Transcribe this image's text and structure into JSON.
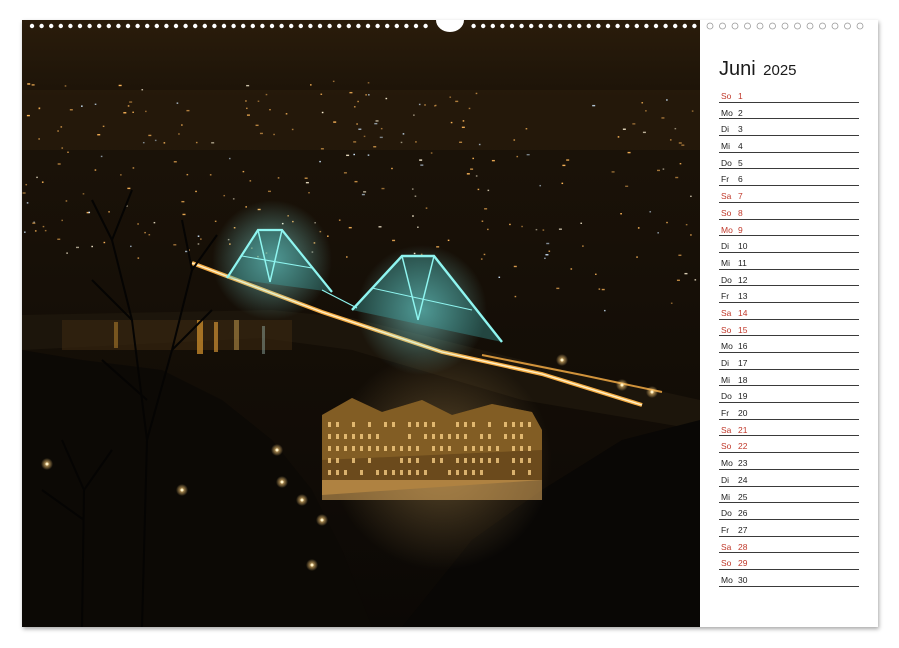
{
  "calendar": {
    "month": "Juni",
    "year": "2025",
    "weekend_color": "#c0392b",
    "days": [
      {
        "name": "So",
        "num": "1",
        "weekend": true
      },
      {
        "name": "Mo",
        "num": "2",
        "weekend": false
      },
      {
        "name": "Di",
        "num": "3",
        "weekend": false
      },
      {
        "name": "Mi",
        "num": "4",
        "weekend": false
      },
      {
        "name": "Do",
        "num": "5",
        "weekend": false
      },
      {
        "name": "Fr",
        "num": "6",
        "weekend": false
      },
      {
        "name": "Sa",
        "num": "7",
        "weekend": true
      },
      {
        "name": "So",
        "num": "8",
        "weekend": true
      },
      {
        "name": "Mo",
        "num": "9",
        "weekend": true
      },
      {
        "name": "Di",
        "num": "10",
        "weekend": false
      },
      {
        "name": "Mi",
        "num": "11",
        "weekend": false
      },
      {
        "name": "Do",
        "num": "12",
        "weekend": false
      },
      {
        "name": "Fr",
        "num": "13",
        "weekend": false
      },
      {
        "name": "Sa",
        "num": "14",
        "weekend": true
      },
      {
        "name": "So",
        "num": "15",
        "weekend": true
      },
      {
        "name": "Mo",
        "num": "16",
        "weekend": false
      },
      {
        "name": "Di",
        "num": "17",
        "weekend": false
      },
      {
        "name": "Mi",
        "num": "18",
        "weekend": false
      },
      {
        "name": "Do",
        "num": "19",
        "weekend": false
      },
      {
        "name": "Fr",
        "num": "20",
        "weekend": false
      },
      {
        "name": "Sa",
        "num": "21",
        "weekend": true
      },
      {
        "name": "So",
        "num": "22",
        "weekend": true
      },
      {
        "name": "Mo",
        "num": "23",
        "weekend": false
      },
      {
        "name": "Di",
        "num": "24",
        "weekend": false
      },
      {
        "name": "Mi",
        "num": "25",
        "weekend": false
      },
      {
        "name": "Do",
        "num": "26",
        "weekend": false
      },
      {
        "name": "Fr",
        "num": "27",
        "weekend": false
      },
      {
        "name": "Sa",
        "num": "28",
        "weekend": true
      },
      {
        "name": "So",
        "num": "29",
        "weekend": true
      },
      {
        "name": "Mo",
        "num": "30",
        "weekend": false
      }
    ]
  },
  "photo": {
    "subject": "night-city-bridge-photo",
    "bridge_color": "#7fe3e0",
    "light_color": "#ffb347"
  }
}
